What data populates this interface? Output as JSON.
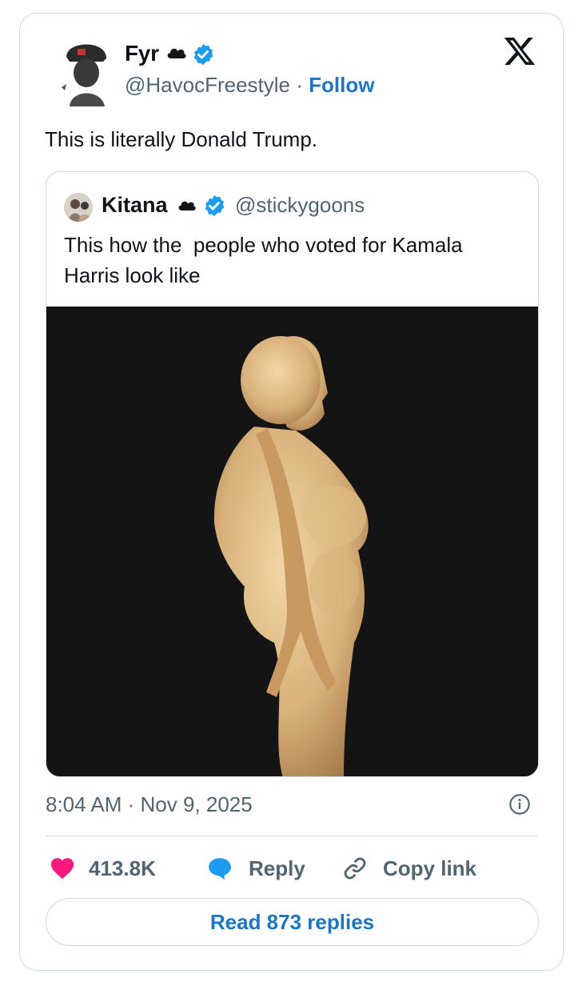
{
  "tweet": {
    "author_name": "Fyr",
    "handle": "@HavocFreestyle",
    "separator": "·",
    "follow_label": "Follow",
    "text": "This is literally Donald Trump.",
    "timestamp": "8:04 AM · Nov 9, 2025"
  },
  "quoted": {
    "author_name": "Kitana",
    "handle": "@stickygoons",
    "text": "This how the  people who voted for Kamala Harris look like"
  },
  "actions": {
    "likes": "413.8K",
    "reply_label": "Reply",
    "copy_label": "Copy link",
    "read_replies_label": "Read 873 replies"
  },
  "icons": [
    "avatar",
    "cloud-icon",
    "verified-badge-icon",
    "x-logo-icon",
    "info-icon",
    "heart-icon",
    "reply-bubble-icon",
    "link-icon"
  ],
  "colors": {
    "brand_blue": "#1d75c4",
    "verified_blue": "#1d9bf0",
    "heart_pink": "#f91880",
    "muted_text": "#536471",
    "border": "#cfd9de"
  }
}
